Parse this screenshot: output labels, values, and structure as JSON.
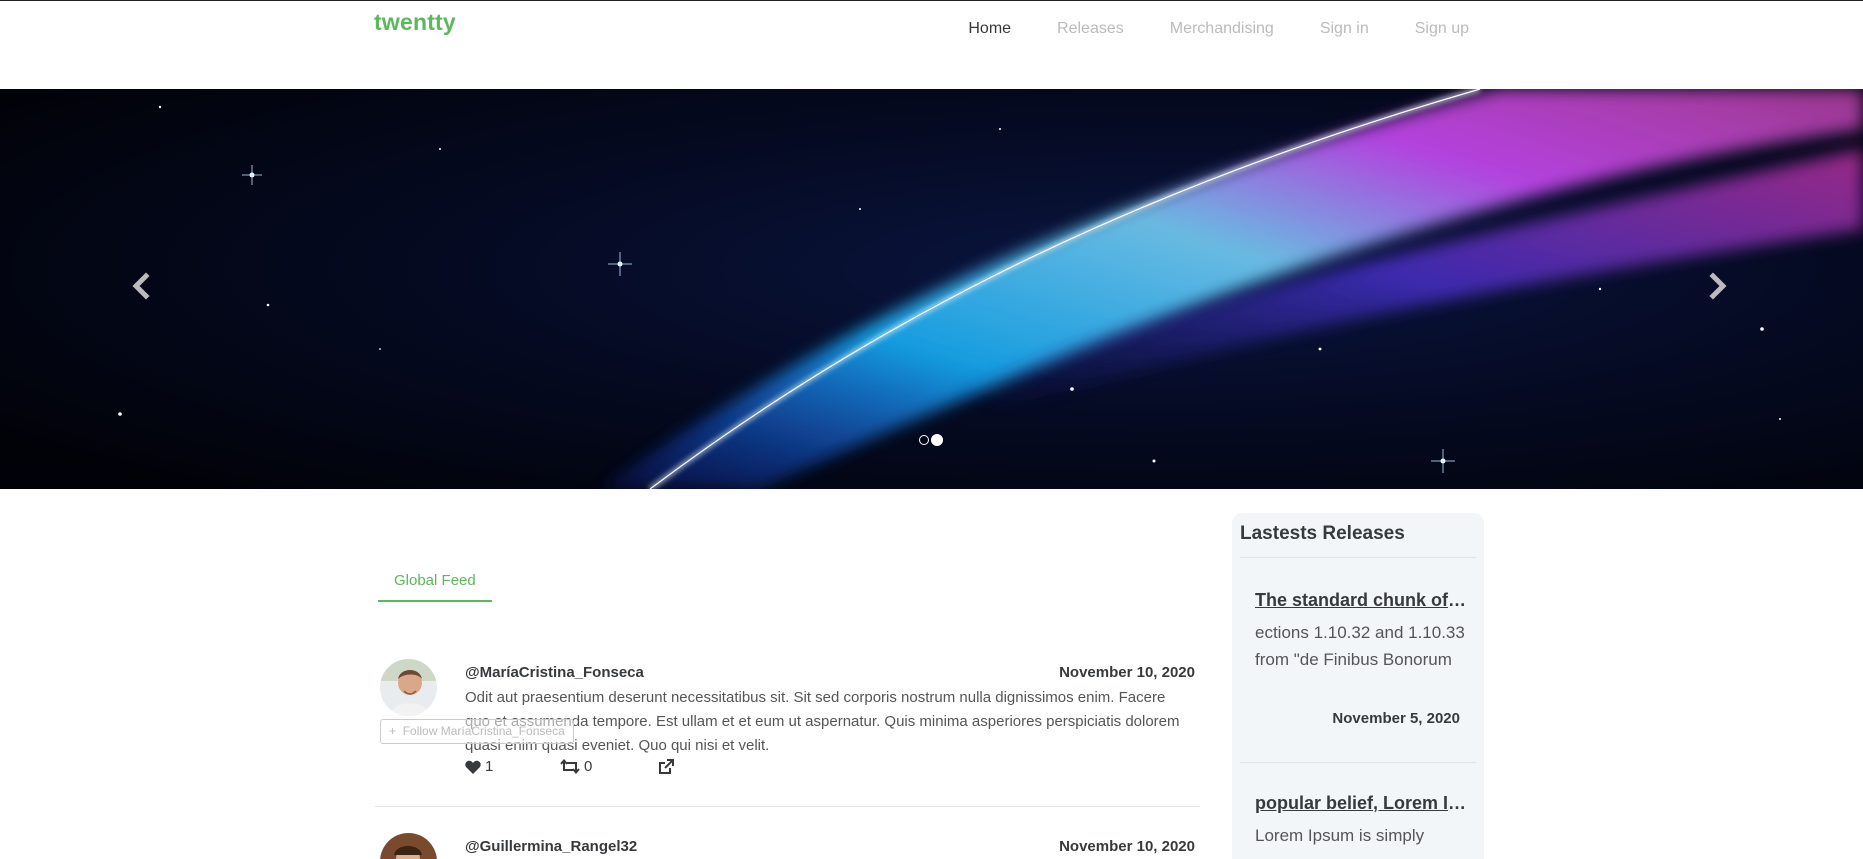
{
  "brand": "twentty",
  "nav": {
    "items": [
      {
        "label": "Home",
        "active": true
      },
      {
        "label": "Releases",
        "active": false
      },
      {
        "label": "Merchandising",
        "active": false
      },
      {
        "label": "Sign in",
        "active": false
      },
      {
        "label": "Sign up",
        "active": false
      }
    ]
  },
  "carousel": {
    "prev_icon": "chevron-left-icon",
    "next_icon": "chevron-right-icon",
    "slide_count": 2,
    "active_slide": 2
  },
  "feed": {
    "tab_label": "Global Feed",
    "posts": [
      {
        "author": "@MaríaCristina_Fonseca",
        "date": "November 10, 2020",
        "body": "Odit aut praesentium deserunt necessitatibus sit. Sit sed corporis nostrum nulla dignissimos enim. Facere quo et assumenda tempore. Est ullam et et eum ut aspernatur. Quis minima asperiores perspiciatis dolorem quasi enim quasi eveniet. Quo qui nisi et velit.",
        "follow_label": "Follow MaríaCristina_Fonseca",
        "likes": "1",
        "retweets": "0"
      },
      {
        "author": "@Guillermina_Rangel32",
        "date": "November 10, 2020"
      }
    ]
  },
  "sidebar": {
    "title": "Lastests Releases",
    "releases": [
      {
        "title": "The standard chunk of Lorem Ipsum",
        "text": "ections 1.10.32 and 1.10.33\nfrom \"de Finibus Bonorum",
        "date": "November 5, 2020"
      },
      {
        "title": "popular belief, Lorem Ipsum",
        "text": "Lorem Ipsum is simply"
      }
    ]
  },
  "colors": {
    "brand_green": "#5cb85c",
    "text_dark": "#373a3c",
    "nav_muted": "#bbbbbb",
    "sidebar_bg": "#f3f6f9"
  }
}
